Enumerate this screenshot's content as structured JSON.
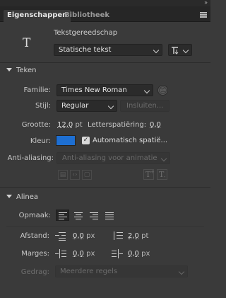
{
  "window": {
    "collapse_glyph": "»"
  },
  "tabs": [
    {
      "label": "Eigenschappen",
      "active": true
    },
    {
      "label": "Bibliotheek",
      "active": false
    }
  ],
  "tool": {
    "icon": "text-tool-icon",
    "glyph": "T",
    "name": "Tekstgereedschap",
    "text_type": "Statische tekst"
  },
  "teken": {
    "header": "Teken",
    "family_label": "Familie:",
    "family_value": "Times New Roman",
    "style_label": "Stijl:",
    "style_value": "Regular",
    "embed_label": "Insluiten...",
    "size_label": "Grootte:",
    "size_value": "12,0",
    "size_unit": "pt",
    "spacing_label": "Letterspatiëring:",
    "spacing_value": "0,0",
    "color_label": "Kleur:",
    "color_hex": "#1e6fd2",
    "autokern_label": "Automatisch spatië...",
    "antialias_label": "Anti-aliasing:",
    "antialias_value": "Anti-aliasing voor animatie",
    "superscript_glyph": "T",
    "subscript_glyph": "T"
  },
  "alinea": {
    "header": "Alinea",
    "format_label": "Opmaak:",
    "spacing_label": "Afstand:",
    "indent_value": "0,0",
    "indent_unit": "px",
    "line_spacing_value": "2,0",
    "line_spacing_unit": "pt",
    "margins_label": "Marges:",
    "left_margin_value": "0,0",
    "left_margin_unit": "px",
    "right_margin_value": "0,0",
    "right_margin_unit": "px",
    "behavior_label": "Gedrag:",
    "behavior_value": "Meerdere regels"
  }
}
